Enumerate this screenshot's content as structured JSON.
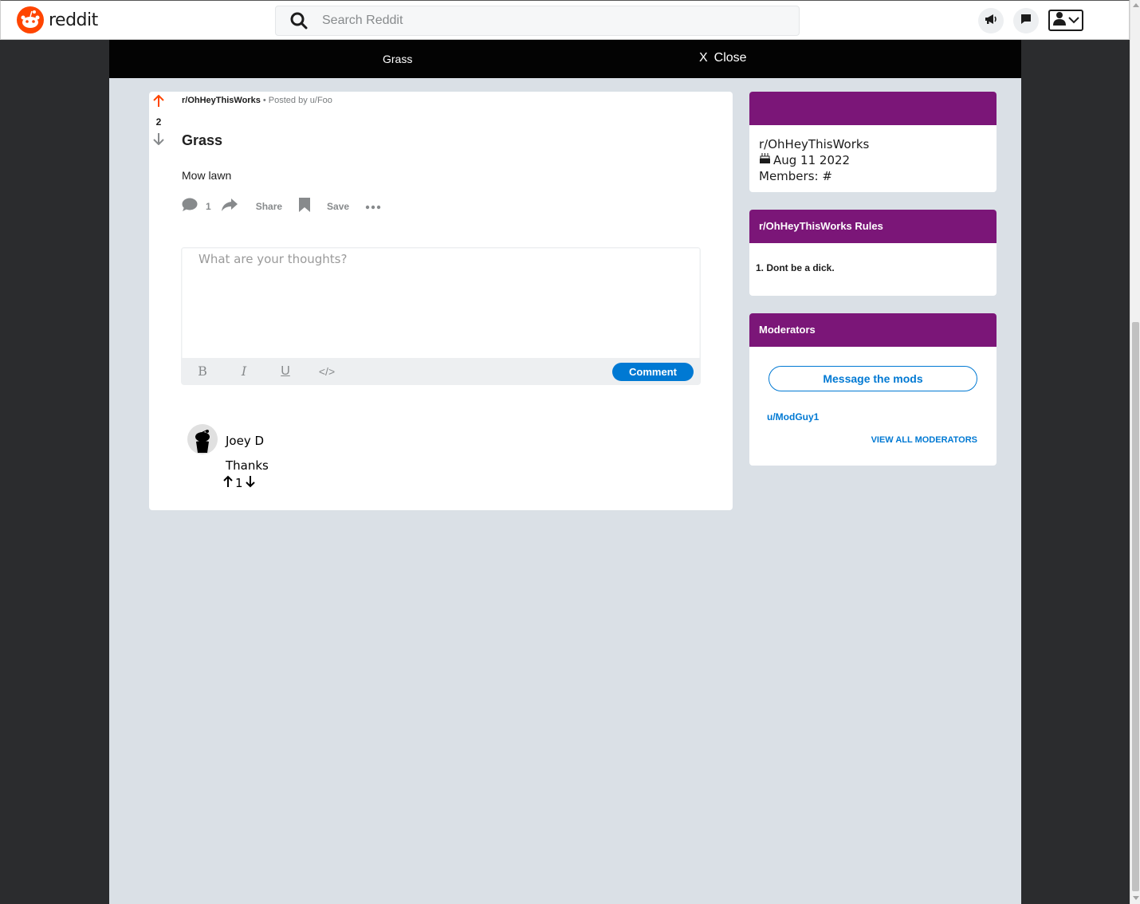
{
  "app": {
    "name": "reddit",
    "brand_color": "#ff4500"
  },
  "search": {
    "placeholder": "Search Reddit"
  },
  "header_icons": [
    "megaphone-icon",
    "chat-icon",
    "user-icon"
  ],
  "overlay": {
    "title": "Grass",
    "close_label": "Close",
    "close_glyph": "X"
  },
  "post": {
    "subreddit": "r/OhHeyThisWorks",
    "posted_by": "• Posted by u/Foo",
    "votes": "2",
    "title": "Grass",
    "body": "Mow lawn",
    "comment_count": "1",
    "share_label": "Share",
    "save_label": "Save"
  },
  "editor": {
    "placeholder": "What are your thoughts?",
    "tools": [
      "B",
      "I",
      "U",
      "</>"
    ],
    "submit_label": "Comment"
  },
  "comments": [
    {
      "author": "Joey D",
      "text": "Thanks",
      "votes": "1"
    }
  ],
  "sidebar": {
    "about": {
      "name": "r/OhHeyThisWorks",
      "created": "Aug 11 2022",
      "members": "Members: #"
    },
    "rules": {
      "title": "r/OhHeyThisWorks Rules",
      "items": [
        "1. Dont be a dick."
      ]
    },
    "moderators": {
      "title": "Moderators",
      "message_label": "Message the mods",
      "mods": [
        "u/ModGuy1"
      ],
      "view_all_label": "VIEW ALL MODERATORS"
    },
    "accent_color": "#7b1678"
  },
  "link_color": "#0079d3",
  "upvote_color": "#ff4500"
}
